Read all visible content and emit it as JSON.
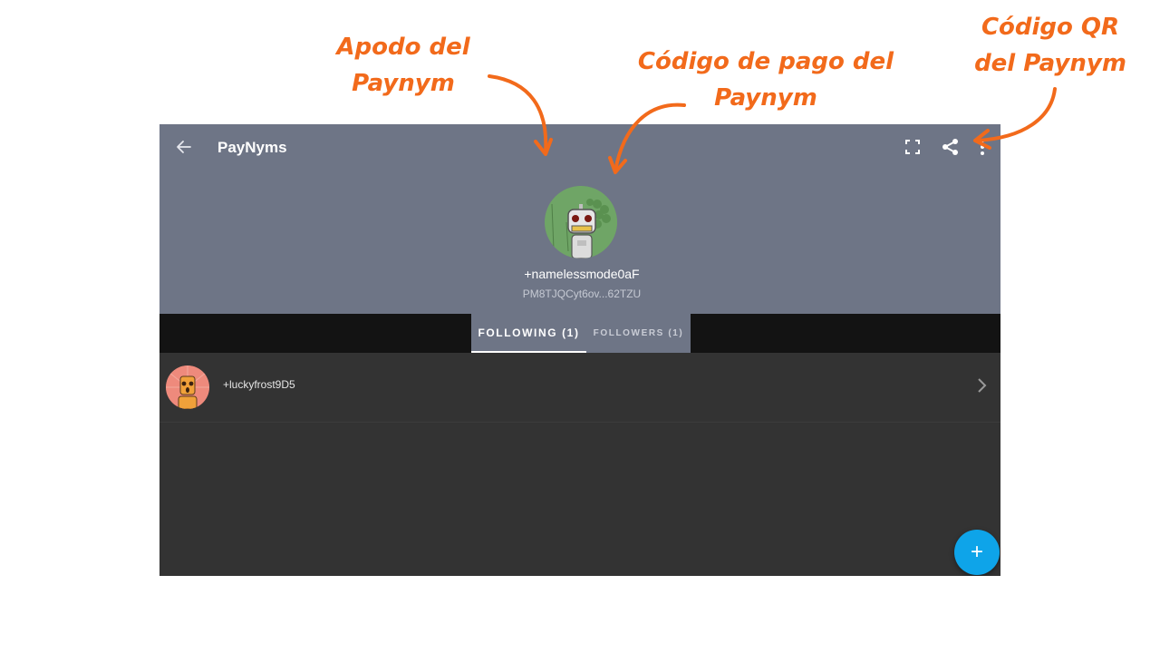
{
  "annotations": {
    "nickname_line1": "Apodo del",
    "nickname_line2": "Paynym",
    "payment_code_line1": "Código de pago del",
    "payment_code_line2": "Paynym",
    "qr_line1": "Código QR",
    "qr_line2": "del Paynym",
    "color": "#f26a1b"
  },
  "app": {
    "title": "PayNyms",
    "header_color": "#6e7586",
    "icons": {
      "back": "back-arrow-icon",
      "expand": "expand-icon",
      "share": "share-icon",
      "more": "more-vertical-icon"
    }
  },
  "profile": {
    "nickname": "+namelessmode0aF",
    "payment_code": "PM8TJQCyt6ov...62TZU"
  },
  "tabs": [
    {
      "label": "FOLLOWING  (1)",
      "active": true
    },
    {
      "label": "FOLLOWERS  (1)",
      "active": false
    }
  ],
  "following": [
    {
      "nickname": "+luckyfrost9D5"
    }
  ],
  "fab": {
    "label": "+",
    "color": "#0ea4e9"
  }
}
